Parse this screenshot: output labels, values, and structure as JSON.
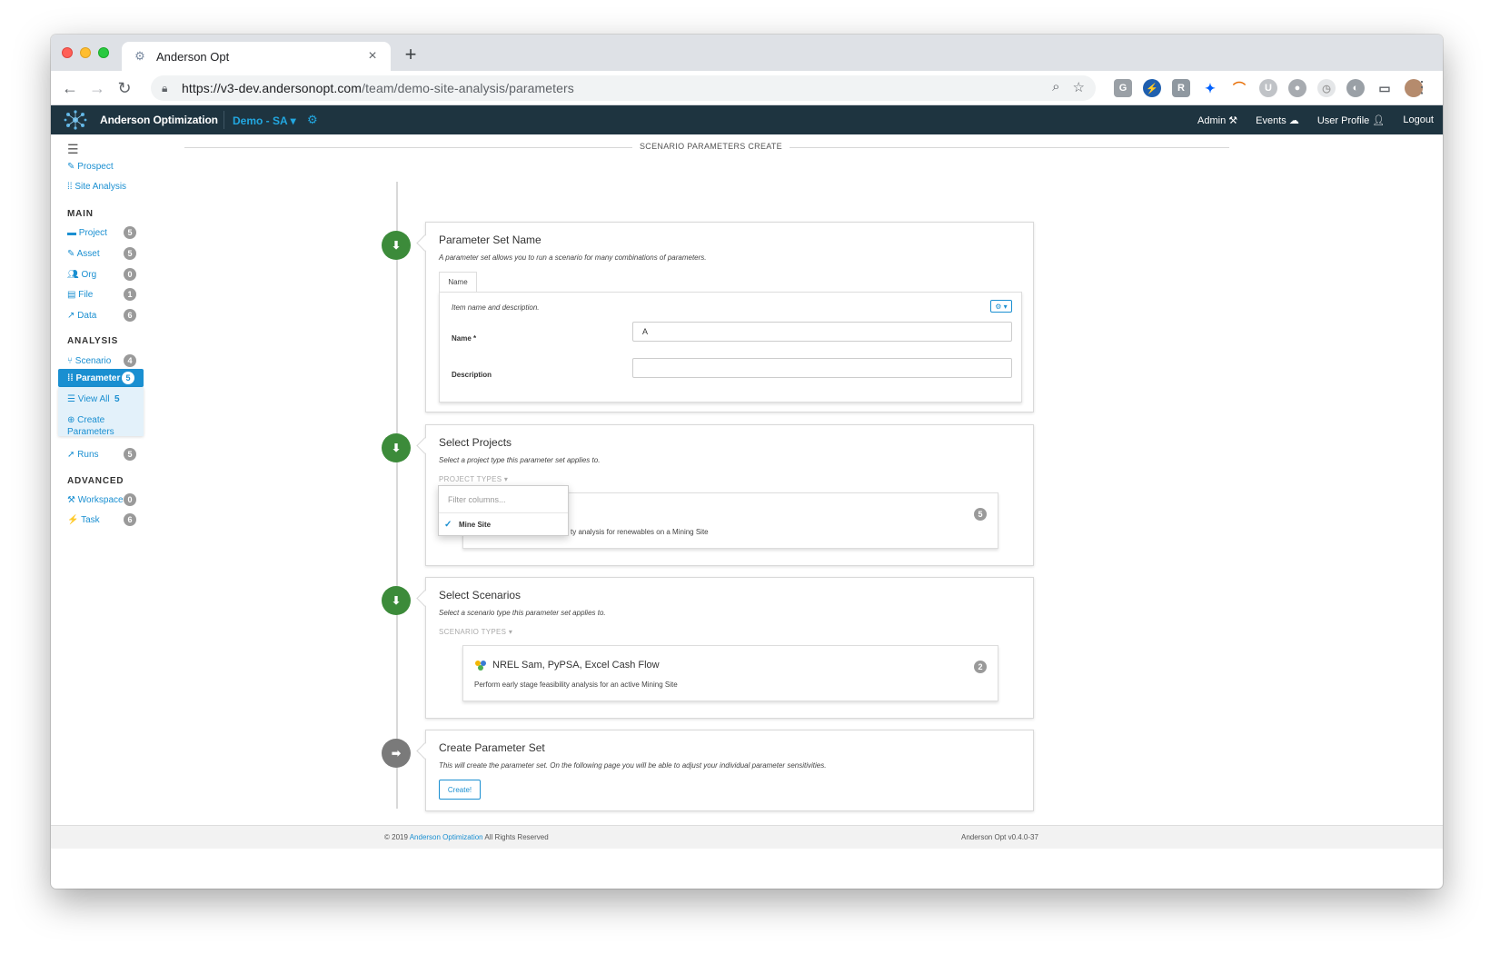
{
  "browser": {
    "tab_title": "Anderson Opt",
    "url_host": "https://v3-dev.andersonopt.com",
    "url_path": "/team/demo-site-analysis/parameters"
  },
  "navbar": {
    "brand": "Anderson Optimization",
    "demo_menu": "Demo - SA",
    "admin": "Admin",
    "events": "Events",
    "user_profile": "User Profile",
    "logout": "Logout"
  },
  "sidebar": {
    "prospect": "Prospect",
    "site_analysis": "Site Analysis",
    "main_heading": "MAIN",
    "main_items": [
      {
        "label": "Project",
        "count": "5"
      },
      {
        "label": "Asset",
        "count": "5"
      },
      {
        "label": "Org",
        "count": "0"
      },
      {
        "label": "File",
        "count": "1"
      },
      {
        "label": "Data",
        "count": "6"
      }
    ],
    "analysis_heading": "ANALYSIS",
    "scenario": {
      "label": "Scenario",
      "count": "4"
    },
    "parameter": {
      "label": "Parameter",
      "count": "5"
    },
    "view_all": {
      "label": "View All",
      "count": "5"
    },
    "create_parameters": "Create Parameters",
    "runs": {
      "label": "Runs",
      "count": "5"
    },
    "advanced_heading": "ADVANCED",
    "workspace": {
      "label": "Workspace",
      "count": "0"
    },
    "task": {
      "label": "Task",
      "count": "6"
    }
  },
  "page": {
    "header": "SCENARIO PARAMETERS CREATE"
  },
  "step1": {
    "title": "Parameter Set Name",
    "description": "A parameter set allows you to run a scenario for many combinations of parameters.",
    "tab": "Name",
    "form_description": "Item name and description.",
    "name_label": "Name *",
    "name_value": "A",
    "description_label": "Description",
    "description_value": ""
  },
  "step2": {
    "title": "Select Projects",
    "description": "Select a project type this parameter set applies to.",
    "toggle": "PROJECT TYPES",
    "card_desc_visible": "ty analysis for renewables on a Mining Site",
    "card_count": "5",
    "dropdown": {
      "filter_placeholder": "Filter columns...",
      "selected_item": "Mine Site"
    }
  },
  "step3": {
    "title": "Select Scenarios",
    "description": "Select a scenario type this parameter set applies to.",
    "toggle": "SCENARIO TYPES",
    "card_title": "NREL Sam, PyPSA, Excel Cash Flow",
    "card_desc": "Perform early stage feasibility analysis for an active Mining Site",
    "card_count": "2"
  },
  "step4": {
    "title": "Create Parameter Set",
    "description": "This will create the parameter set. On the following page you will be able to adjust your individual parameter sensitivities.",
    "button": "Create!"
  },
  "footer": {
    "copyright_prefix": "© 2019",
    "company_link": "Anderson Optimization",
    "copyright_suffix": "All Rights Reserved",
    "version": "Anderson Opt v0.4.0-37"
  },
  "colors": {
    "navbar_bg": "#1e3440",
    "accent": "#1a8fd1",
    "step_green": "#3c8b3a",
    "step_gray": "#7a7a7a"
  }
}
